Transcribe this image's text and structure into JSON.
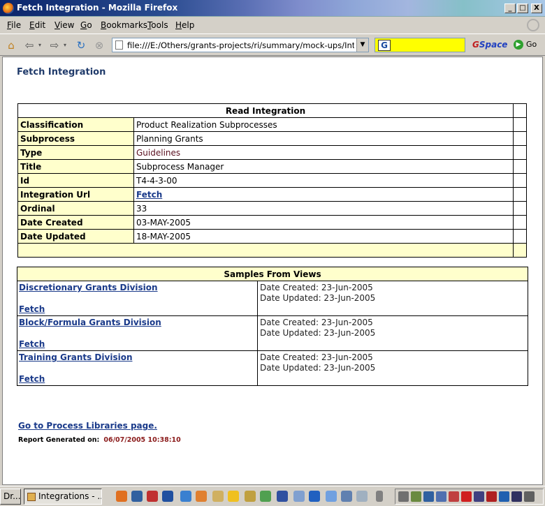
{
  "window": {
    "title": "Fetch Integration - Mozilla Firefox",
    "min": "_",
    "max": "□",
    "close": "X"
  },
  "menu": [
    "File",
    "Edit",
    "View",
    "Go",
    "Bookmarks",
    "Tools",
    "Help"
  ],
  "nav": {
    "url": "file:///E:/Others/grants-projects/ri/summary/mock-ups/Integration",
    "search_value": "",
    "gspace_g": "G",
    "gspace_rest": "Space",
    "go_label": "Go"
  },
  "page": {
    "title": "Fetch Integration",
    "integration": {
      "header": "Read Integration",
      "rows": [
        {
          "label": "Classification",
          "value": "Product Realization Subprocesses"
        },
        {
          "label": "Subprocess",
          "value": "Planning Grants"
        },
        {
          "label": "Type",
          "value": "Guidelines"
        },
        {
          "label": "Title",
          "value": "Subprocess Manager"
        },
        {
          "label": "Id",
          "value": "T4-4-3-00"
        },
        {
          "label": "Integration Url",
          "value": "Fetch"
        },
        {
          "label": "Ordinal",
          "value": "33"
        },
        {
          "label": "Date Created",
          "value": "03-MAY-2005"
        },
        {
          "label": "Date Updated",
          "value": "18-MAY-2005"
        }
      ]
    },
    "samples": {
      "header": "Samples From Views",
      "rows": [
        {
          "name": "Discretionary Grants Division",
          "fetch": "Fetch",
          "created": "Date Created: 23-Jun-2005",
          "updated": "Date Updated: 23-Jun-2005"
        },
        {
          "name": "Block/Formula Grants Division",
          "fetch": "Fetch",
          "created": "Date Created: 23-Jun-2005",
          "updated": "Date Updated: 23-Jun-2005"
        },
        {
          "name": "Training Grants Division",
          "fetch": "Fetch",
          "created": "Date Created: 23-Jun-2005",
          "updated": "Date Updated: 23-Jun-2005"
        }
      ]
    },
    "process_link": "Go to Process Libraries page.",
    "report_label": "Report Generated on:",
    "report_time": "06/07/2005 10:38:10"
  },
  "taskbar": {
    "tasks": [
      "Dr...",
      "Integrations - ..."
    ]
  }
}
